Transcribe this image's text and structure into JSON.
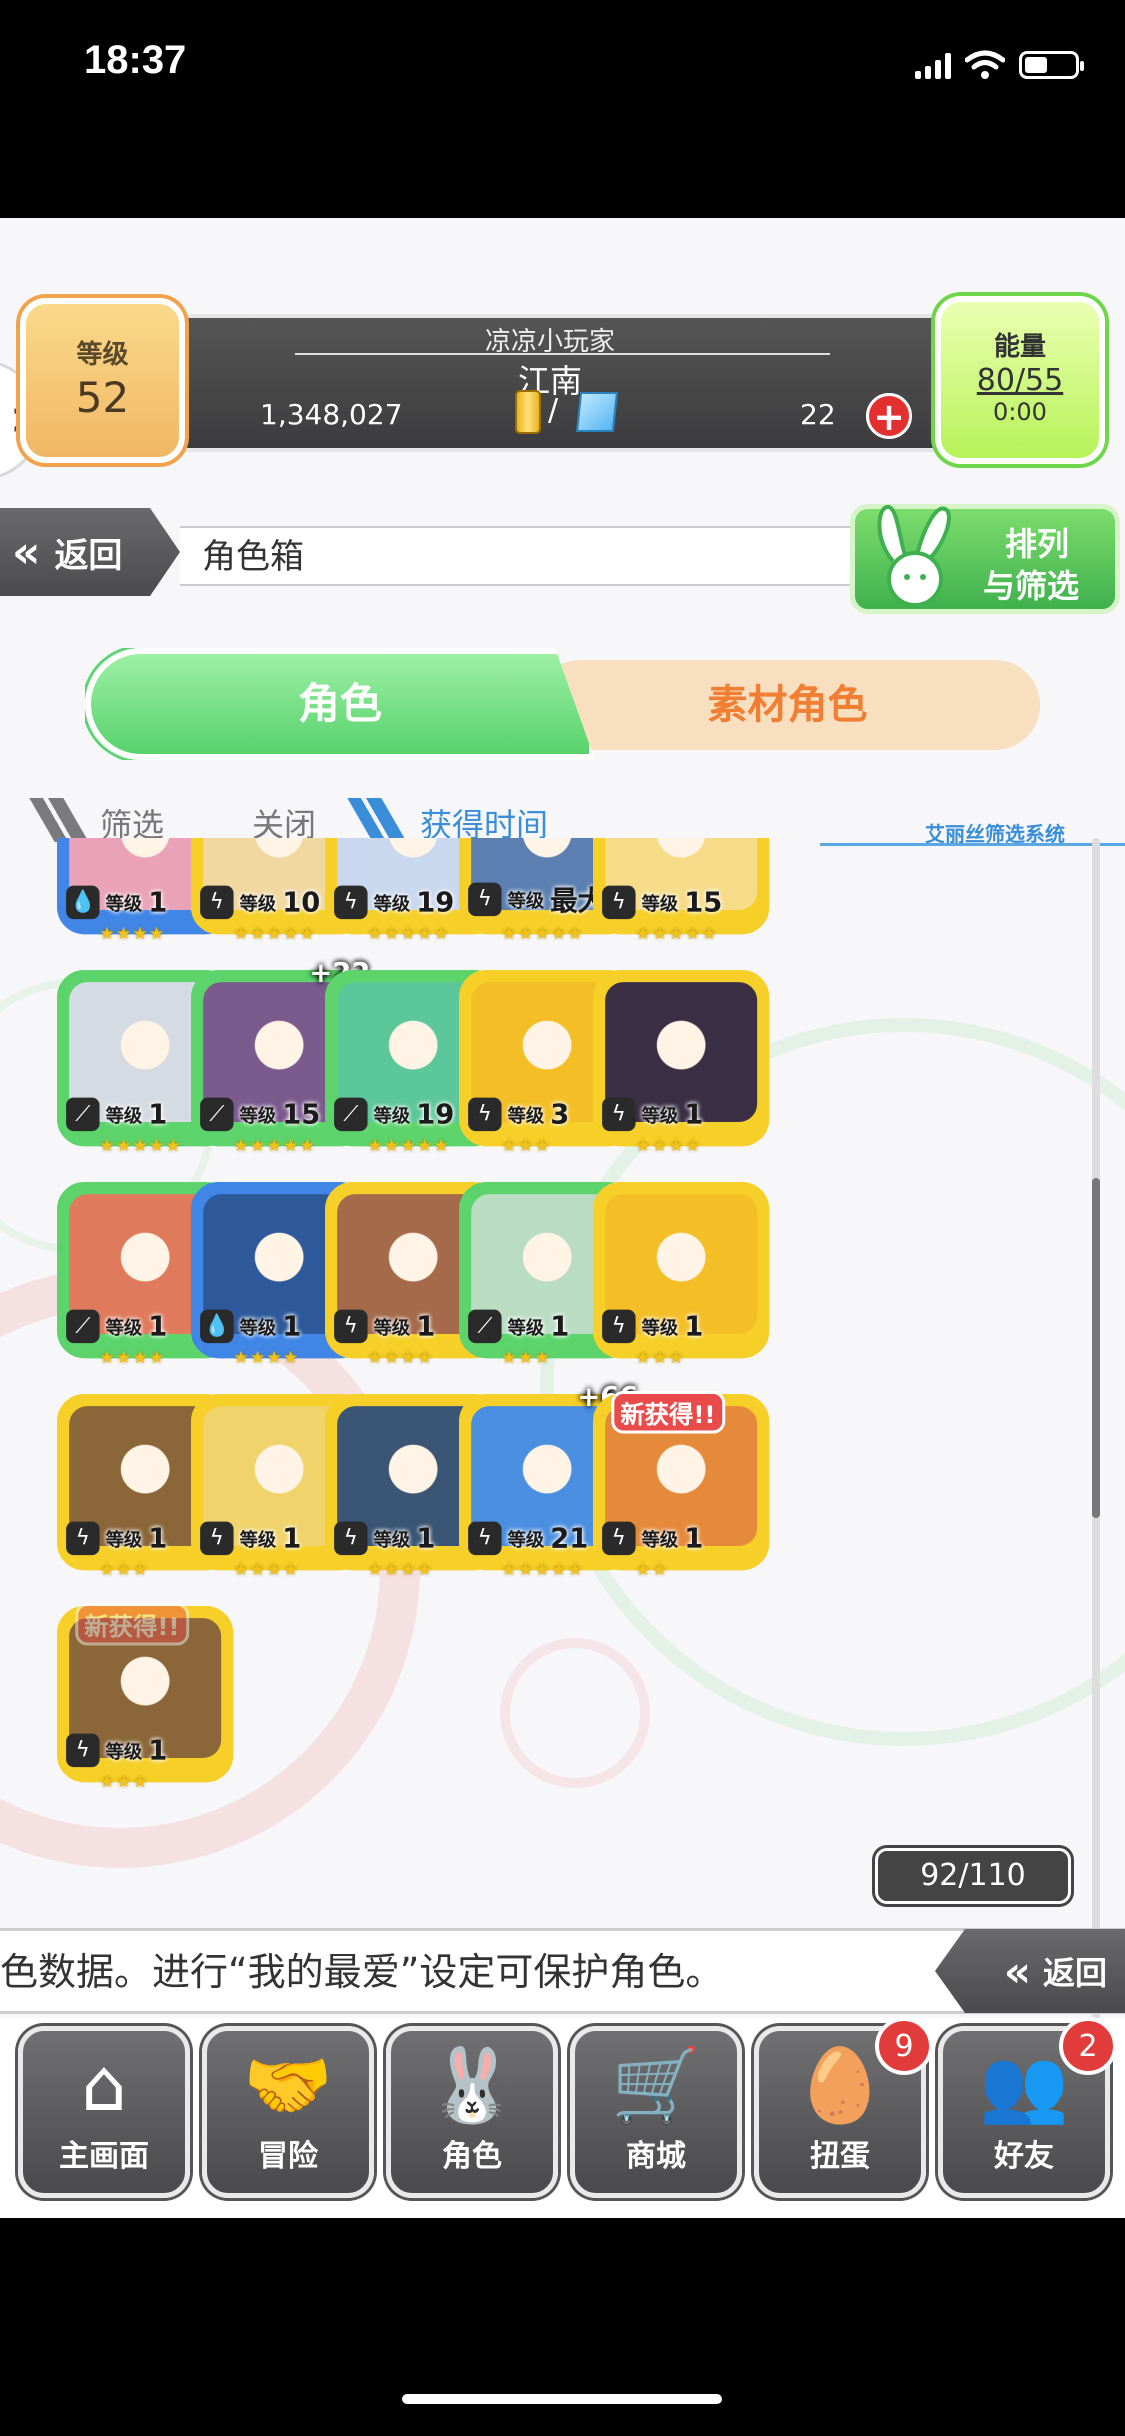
{
  "status": {
    "time": "18:37"
  },
  "header": {
    "level_label": "等级",
    "level_value": "52",
    "player_name": "凉凉小玩家",
    "region": "江南",
    "gold": "1,348,027",
    "slash": "/",
    "gems": "22",
    "energy_label": "能量",
    "energy_value": "80/55",
    "energy_timer": "0:00"
  },
  "title_row": {
    "back_label": "返回",
    "page_title": "角色箱",
    "sort_filter_line1": "排列",
    "sort_filter_line2": "与筛选"
  },
  "tabs": {
    "role": "角色",
    "material": "素材角色"
  },
  "filter": {
    "filter_label": "筛选",
    "filter_state": "关闭",
    "sort_label": "获得时间",
    "system_label": "艾丽丝筛选系统"
  },
  "level_prefix": "等级",
  "cards": [
    {
      "color": "blue",
      "element": "water",
      "level": "1",
      "stars": "★★★★",
      "art": "#e9a2b7"
    },
    {
      "color": "yellow",
      "element": "thunder",
      "level": "10",
      "stars": "★★★★★",
      "art": "#f1d7a0"
    },
    {
      "color": "yellow",
      "element": "thunder",
      "level": "19",
      "stars": "★★★★★",
      "art": "#c9d8ee"
    },
    {
      "color": "yellow",
      "element": "thunder",
      "level": "最大",
      "stars": "★★★★★",
      "art": "#5a7fb0"
    },
    {
      "color": "yellow",
      "element": "thunder",
      "level": "15",
      "stars": "★★★★★",
      "art": "#f6dc89"
    },
    {
      "color": "green",
      "element": "wind",
      "level": "1",
      "stars": "★★★★★",
      "art": "#d5dbe2"
    },
    {
      "color": "green",
      "element": "wind",
      "level": "15",
      "stars": "★★★★★",
      "art": "#7b5a8e",
      "plus": "+22"
    },
    {
      "color": "green",
      "element": "wind",
      "level": "19",
      "stars": "★★★★★",
      "art": "#5cc79a"
    },
    {
      "color": "yellow",
      "element": "thunder",
      "level": "3",
      "stars": "★★★",
      "art": "#f3be26"
    },
    {
      "color": "yellow",
      "element": "thunder",
      "level": "1",
      "stars": "★★★★",
      "art": "#3b2f46"
    },
    {
      "color": "green",
      "element": "wind",
      "level": "1",
      "stars": "★★★★",
      "art": "#e07a5c"
    },
    {
      "color": "blue",
      "element": "water",
      "level": "1",
      "stars": "★★★★",
      "art": "#2e5a9b"
    },
    {
      "color": "yellow",
      "element": "thunder",
      "level": "1",
      "stars": "★★★★",
      "art": "#a46a4a"
    },
    {
      "color": "green",
      "element": "wind",
      "level": "1",
      "stars": "★★★",
      "art": "#b9dcc3"
    },
    {
      "color": "yellow",
      "element": "thunder",
      "level": "1",
      "stars": "★★★",
      "art": "#f3be26"
    },
    {
      "color": "yellow",
      "element": "thunder",
      "level": "1",
      "stars": "★★★",
      "art": "#8a6638"
    },
    {
      "color": "yellow",
      "element": "thunder",
      "level": "1",
      "stars": "★★★★",
      "art": "#f0d36a"
    },
    {
      "color": "yellow",
      "element": "thunder",
      "level": "1",
      "stars": "★★★★",
      "art": "#3b5674"
    },
    {
      "color": "yellow",
      "element": "thunder",
      "level": "21",
      "stars": "★★★★★",
      "art": "#4b8fe0",
      "plus": "+66"
    },
    {
      "color": "yellow",
      "element": "thunder",
      "level": "1",
      "stars": "★★",
      "art": "#e48a3a",
      "new": "新获得!!"
    },
    {
      "color": "yellow",
      "element": "thunder",
      "level": "1",
      "stars": "★★★",
      "art": "#8a6638",
      "new": "新获得!!",
      "new_faded": true
    }
  ],
  "count": "92/110",
  "info_text": "色数据。进行“我的最爱”设定可保护角色。",
  "back_label2": "返回",
  "nav": [
    {
      "label": "主画面",
      "icon": "home-icon"
    },
    {
      "label": "冒险",
      "icon": "handshake-icon"
    },
    {
      "label": "角色",
      "icon": "bunny-icon"
    },
    {
      "label": "商城",
      "icon": "cart-icon"
    },
    {
      "label": "扭蛋",
      "icon": "egg-icon",
      "badge": "9"
    },
    {
      "label": "好友",
      "icon": "friends-icon",
      "badge": "2"
    }
  ],
  "colors": {
    "green": "#5cd46b",
    "yellow": "#f6cf28",
    "blue": "#3f86e6",
    "accent_orange": "#f07e33"
  }
}
